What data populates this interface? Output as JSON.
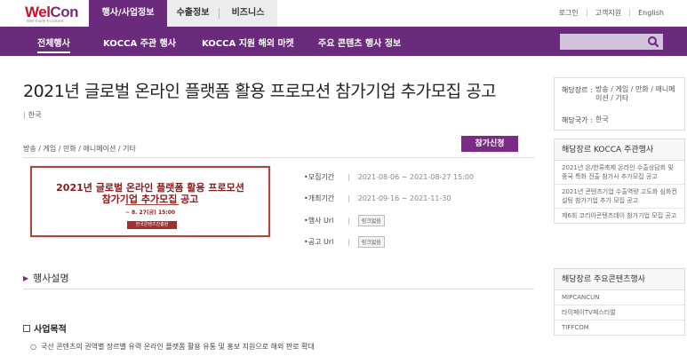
{
  "brand": {
    "logo_main": "WelCon",
    "logo_tag": "Well-made K-content"
  },
  "top_tabs": [
    {
      "label": "행사/사업정보",
      "active": true
    },
    {
      "label": "수출정보"
    },
    {
      "label": "비즈니스"
    }
  ],
  "utility": {
    "login": "로그인",
    "support": "고객지원",
    "english": "English"
  },
  "nav": {
    "items": [
      "전체행사",
      "KOCCA 주관 행사",
      "KOCCA 지원 해외 마켓",
      "주요 콘텐츠 행사 정보"
    ],
    "search_placeholder": ""
  },
  "event": {
    "title": "2021년 글로벌 온라인 플랫폼 활용 프로모션 참가기업 추가모집 공고",
    "country": "한국",
    "genre": "방송 / 게임 / 만화 / 애니메이션 / 기타",
    "apply_label": "참가신청",
    "banner": {
      "line1": "2021년 글로벌 온라인 플랫폼 활용 프로모션",
      "line2": "참가기업 추가모집 공고",
      "date": "~ 8. 27(금) 15:00",
      "org": "한국콘텐츠진흥원"
    },
    "info": [
      {
        "label": "모집기간",
        "value": "2021-08-06 ~ 2021-08-27 15:00",
        "type": "text"
      },
      {
        "label": "개최기간",
        "value": "2021-09-16 ~ 2021-11-30",
        "type": "text"
      },
      {
        "label": "행사 Url",
        "value": "링크없음",
        "type": "chip"
      },
      {
        "label": "공고 Url",
        "value": "링크없음",
        "type": "chip"
      }
    ]
  },
  "description": {
    "section_title": "행사설명",
    "subheading": "사업목적",
    "bullet": "국산 콘텐츠의 권역별 장르별 유력 온라인 플랫폼 활용 유통 및 홍보 지원으로 해외 판로 확대"
  },
  "sidebar": {
    "genre_label": "해당장르 :",
    "genre_value": "방송 / 게임 / 만화 / 애니메이션 / 기타",
    "country_label": "해당국가 :",
    "country_value": "한국",
    "kocca_title": "해당장르 KOCCA 주관행사",
    "kocca_items": [
      "2021년 온/한류축제 온라인 수출상담회 및 중국 특화 진출 참가사 추가모집 공고",
      "2021년 콘텐츠기업 수출역량 고도화 심화컨설팅 참가기업 추가 모집 공고",
      "제6회 코리아콘텐츠데이 참가기업 모집 공고"
    ],
    "major_title": "해당장르 주요콘텐츠행사",
    "major_items": [
      "MIPCANCUN",
      "타이페이TV페스티벌",
      "TIFFCOM"
    ]
  },
  "colors": {
    "brand_purple": "#6b2b7d",
    "accent_red": "#c8102e"
  }
}
